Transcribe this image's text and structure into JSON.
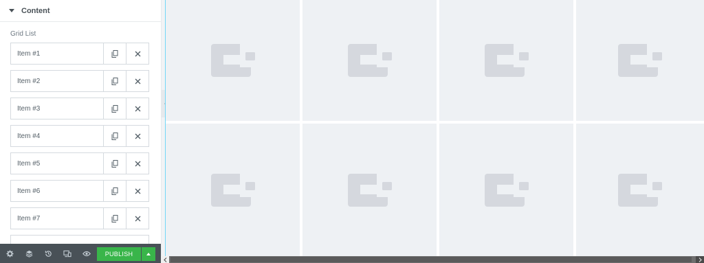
{
  "section": {
    "title": "Content"
  },
  "control": {
    "label": "Grid List"
  },
  "repeater": {
    "items": [
      {
        "label": "Item #1"
      },
      {
        "label": "Item #2"
      },
      {
        "label": "Item #3"
      },
      {
        "label": "Item #4"
      },
      {
        "label": "Item #5"
      },
      {
        "label": "Item #6"
      },
      {
        "label": "Item #7"
      }
    ]
  },
  "footer": {
    "publish_label": "PUBLISH",
    "icons": [
      "gear-icon",
      "layers-icon",
      "history-icon",
      "responsive-icon",
      "eye-icon"
    ]
  },
  "colors": {
    "publish": "#39b54a",
    "footer": "#495157",
    "tile": "#eef1f4",
    "placeholder_logo": "#d5d8de",
    "accent_line": "#71d7f7"
  },
  "preview": {
    "tile_count": 8
  }
}
